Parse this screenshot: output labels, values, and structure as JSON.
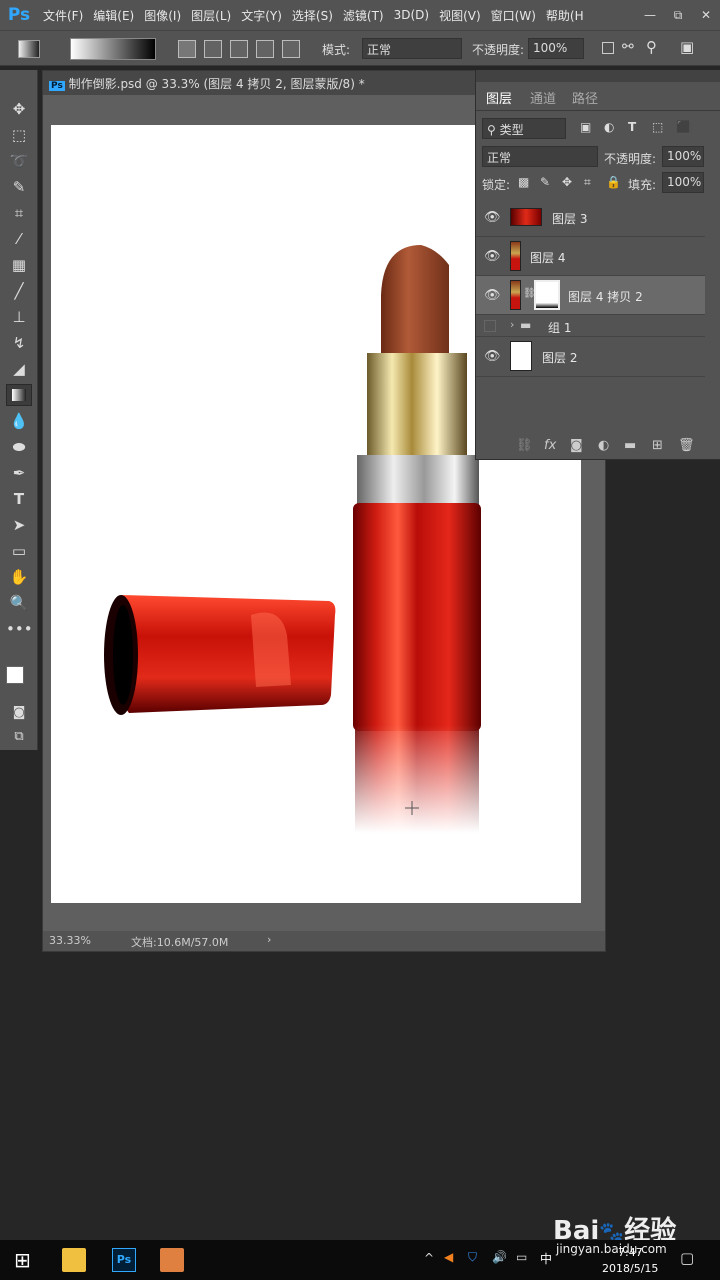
{
  "menubar": {
    "logo": "Ps",
    "items": [
      "文件(F)",
      "编辑(E)",
      "图像(I)",
      "图层(L)",
      "文字(Y)",
      "选择(S)",
      "滤镜(T)",
      "3D(D)",
      "视图(V)",
      "窗口(W)",
      "帮助(H"
    ],
    "win_controls": [
      "—",
      "⧉",
      "✕"
    ]
  },
  "options": {
    "mode_label": "模式:",
    "mode_value": "正常",
    "opacity_label": "不透明度:",
    "opacity_value": "100%"
  },
  "document": {
    "tab_title": "制作倒影.psd @ 33.3% (图层 4 拷贝 2, 图层蒙版/8) *",
    "zoom": "33.33%",
    "doc_size": "文档:10.6M/57.0M",
    "status_arrow": "›"
  },
  "layers_panel": {
    "tabs": [
      "图层",
      "通道",
      "路径"
    ],
    "filter": "类型",
    "blend_mode": "正常",
    "opacity_label": "不透明度:",
    "opacity_value": "100%",
    "lock_label": "锁定:",
    "fill_label": "填充:",
    "fill_value": "100%",
    "layers": [
      {
        "name": "图层 3",
        "visible": true
      },
      {
        "name": "图层 4",
        "visible": true
      },
      {
        "name": "图层 4 拷贝 2",
        "visible": true,
        "selected": true
      },
      {
        "name": "组 1",
        "visible": false
      },
      {
        "name": "图层 2",
        "visible": true
      }
    ],
    "bottom_icons": [
      "link-icon",
      "fx-icon",
      "mask-icon",
      "adjustment-icon",
      "folder-icon",
      "new-layer-icon",
      "trash-icon"
    ]
  },
  "taskbar": {
    "time": "7:47",
    "date": "2018/5/15",
    "ime": "中"
  },
  "watermark": {
    "brand": "Bai",
    "brand2": "经验",
    "url": "jingyan.baidu.com"
  },
  "colors": {
    "accent": "#31a8ff",
    "lipstick_red": "#c8140f"
  }
}
